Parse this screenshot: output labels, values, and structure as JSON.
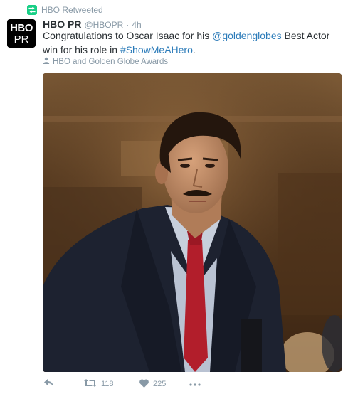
{
  "retweet": {
    "label": "HBO Retweeted"
  },
  "tweet": {
    "avatar": {
      "line1": "HBO",
      "line2": "PR"
    },
    "author": {
      "name": "HBO PR",
      "handle": "@HBOPR",
      "separator": "·",
      "time": "4h"
    },
    "text": {
      "part1": "Congratulations to Oscar Isaac for his ",
      "mention": "@goldenglobes",
      "part2": " Best Actor win for his role in ",
      "hashtag": "#ShowMeAHero",
      "part3": "."
    },
    "tagged": "HBO and Golden Globe Awards",
    "actions": {
      "retweet_count": "118",
      "like_count": "225"
    }
  },
  "icons": {
    "retweet_badge": "retweet-icon",
    "person": "person-icon",
    "reply": "reply-icon",
    "retweet": "retweet-icon",
    "like": "heart-icon",
    "more": "more-icon"
  },
  "colors": {
    "link": "#2b7bb9",
    "retweet_green": "#19cf86",
    "meta_gray": "#8899a6",
    "text": "#292f33"
  }
}
